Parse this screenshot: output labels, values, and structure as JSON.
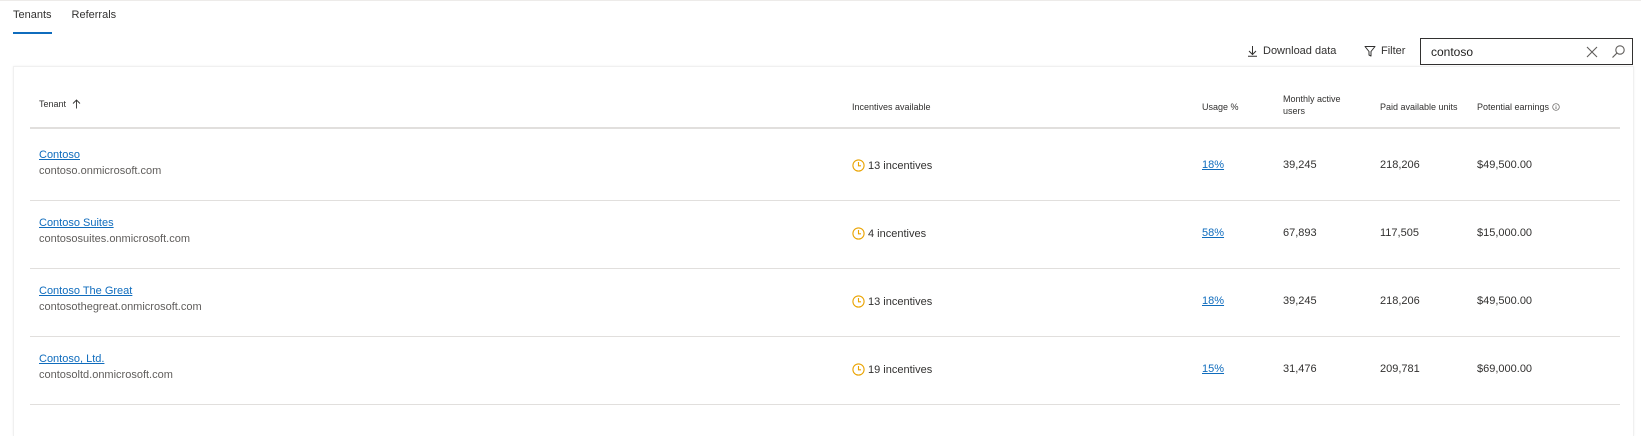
{
  "tabs": [
    {
      "label": "Tenants",
      "active": true
    },
    {
      "label": "Referrals",
      "active": false
    }
  ],
  "toolbar": {
    "download_label": "Download data",
    "filter_label": "Filter"
  },
  "search": {
    "value": "contoso",
    "placeholder": "Search"
  },
  "table": {
    "headers": {
      "tenant": "Tenant",
      "incentives": "Incentives available",
      "usage": "Usage %",
      "mau": "Monthly active users",
      "paid": "Paid available units",
      "earnings": "Potential earnings"
    },
    "rows": [
      {
        "name": "Contoso",
        "domain": "contoso.onmicrosoft.com",
        "incentives": "13 incentives",
        "usage": "18%",
        "mau": "39,245",
        "paid": "218,206",
        "earnings": "$49,500.00"
      },
      {
        "name": "Contoso Suites",
        "domain": "contososuites.onmicrosoft.com",
        "incentives": "4 incentives",
        "usage": "58%",
        "mau": "67,893",
        "paid": "117,505",
        "earnings": "$15,000.00"
      },
      {
        "name": "Contoso The Great",
        "domain": "contosothegreat.onmicrosoft.com",
        "incentives": "13 incentives",
        "usage": "18%",
        "mau": "39,245",
        "paid": "218,206",
        "earnings": "$49,500.00"
      },
      {
        "name": "Contoso, Ltd.",
        "domain": "contosoltd.onmicrosoft.com",
        "incentives": "19 incentives",
        "usage": "15%",
        "mau": "31,476",
        "paid": "209,781",
        "earnings": "$69,000.00"
      }
    ]
  },
  "colors": {
    "accent": "#0f6cbd",
    "clock_icon": "#eaa300"
  }
}
